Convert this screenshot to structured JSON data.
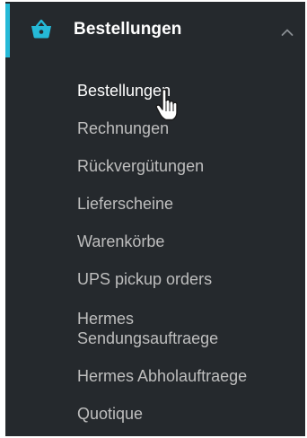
{
  "menu": {
    "section_label": "Bestellungen",
    "section_icon": "basket-icon",
    "toggle_icon": "chevron-up-icon",
    "accent_color": "#25b9d7",
    "items": [
      {
        "label": "Bestellungen",
        "active": true
      },
      {
        "label": "Rechnungen",
        "active": false
      },
      {
        "label": "Rückvergütungen",
        "active": false
      },
      {
        "label": "Lieferscheine",
        "active": false
      },
      {
        "label": "Warenkörbe",
        "active": false
      },
      {
        "label": "UPS pickup orders",
        "active": false
      },
      {
        "label_line1": "Hermes",
        "label_line2": "Sendungsauftraege",
        "active": false
      },
      {
        "label": "Hermes Abholauftraege",
        "active": false
      },
      {
        "label": "Quotique",
        "active": false
      }
    ]
  }
}
